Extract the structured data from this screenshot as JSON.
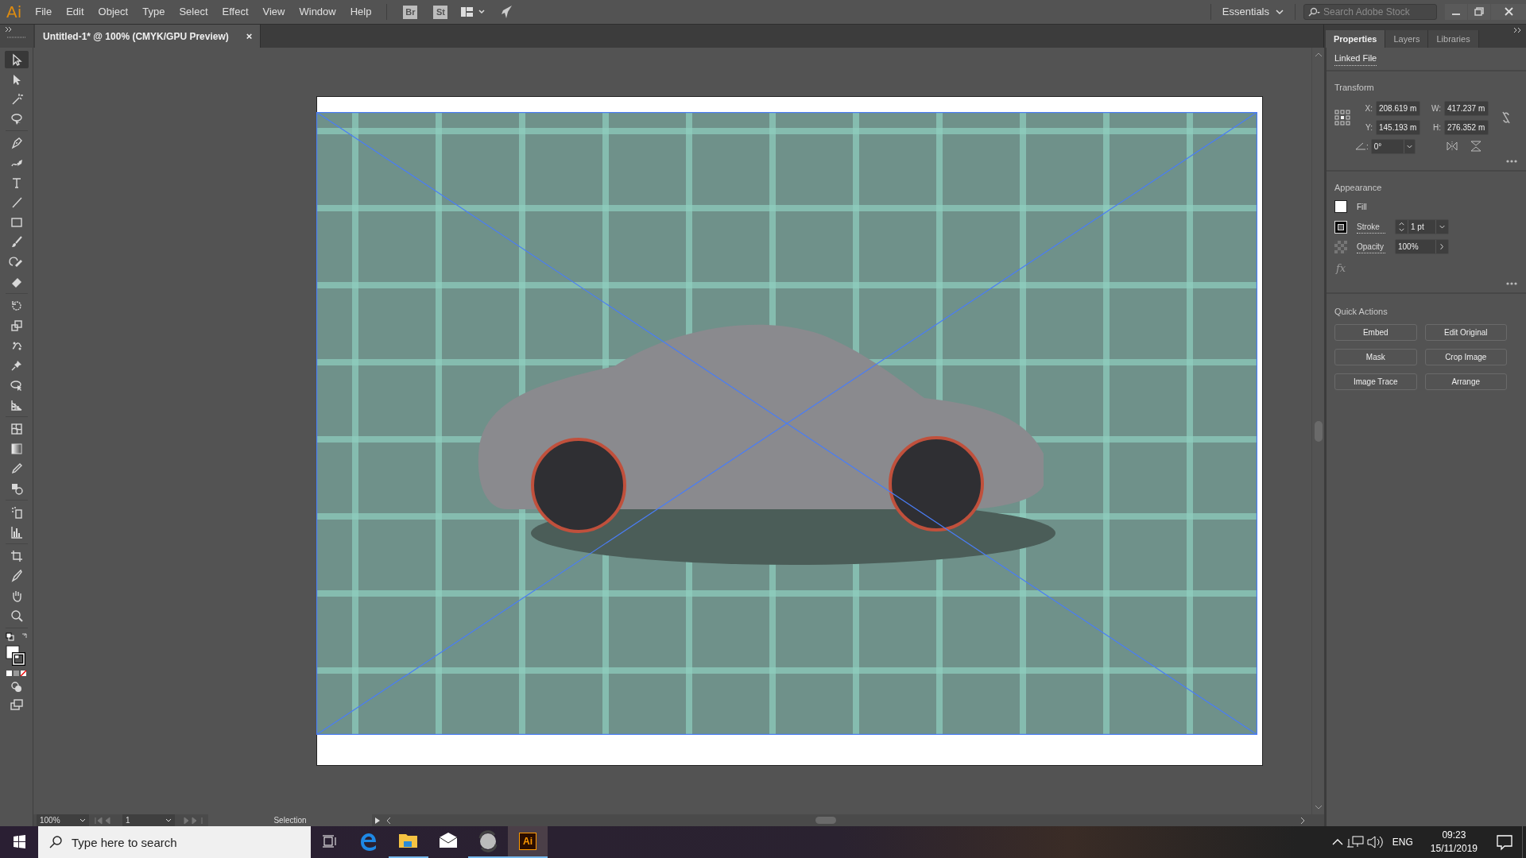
{
  "app_logo": "Ai",
  "menu": [
    "File",
    "Edit",
    "Object",
    "Type",
    "Select",
    "Effect",
    "View",
    "Window",
    "Help"
  ],
  "bridge_buttons": [
    "Br",
    "St"
  ],
  "workspace": "Essentials",
  "stock_search": {
    "placeholder": "Search Adobe Stock"
  },
  "document_tab": {
    "title": "Untitled-1* @ 100% (CMYK/GPU Preview)",
    "close": "×"
  },
  "tools": [
    {
      "kind": "selection",
      "selected": true
    },
    {
      "kind": "direct",
      "selected": false
    },
    {
      "kind": "wand",
      "selected": false
    },
    {
      "kind": "lasso",
      "selected": false
    },
    {
      "kind": "pen",
      "selected": false
    },
    {
      "kind": "curvature",
      "selected": false
    },
    {
      "kind": "type",
      "selected": false
    },
    {
      "kind": "line",
      "selected": false
    },
    {
      "kind": "rect",
      "selected": false
    },
    {
      "kind": "brush",
      "selected": false
    },
    {
      "kind": "shaper",
      "selected": false
    },
    {
      "kind": "eraser",
      "selected": false
    },
    {
      "kind": "rotate",
      "selected": false
    },
    {
      "kind": "scale",
      "selected": false
    },
    {
      "kind": "warp",
      "selected": false
    },
    {
      "kind": "pin",
      "selected": false
    },
    {
      "kind": "builder",
      "selected": false
    },
    {
      "kind": "perspective",
      "selected": false
    },
    {
      "kind": "mesh",
      "selected": false
    },
    {
      "kind": "gradient",
      "selected": false
    },
    {
      "kind": "eyedropper",
      "selected": false
    },
    {
      "kind": "blend",
      "selected": false
    },
    {
      "kind": "sprayer",
      "selected": false
    },
    {
      "kind": "graph",
      "selected": false
    },
    {
      "kind": "artboard",
      "selected": false
    },
    {
      "kind": "slice",
      "selected": false
    },
    {
      "kind": "hand",
      "selected": false
    },
    {
      "kind": "zoom",
      "selected": false
    }
  ],
  "panel": {
    "tabs": [
      {
        "label": "Properties",
        "selected": true
      },
      {
        "label": "Layers",
        "selected": false
      },
      {
        "label": "Libraries",
        "selected": false
      }
    ],
    "object_type": "Linked File",
    "transform": {
      "title": "Transform",
      "fields": [
        {
          "label": "X:",
          "value": "208.619 m"
        },
        {
          "label": "W:",
          "value": "417.237 m"
        },
        {
          "label": "Y:",
          "value": "145.193 m"
        },
        {
          "label": "H:",
          "value": "276.352 m"
        }
      ],
      "angle_label": ":",
      "angle_value": "0°"
    },
    "appearance": {
      "title": "Appearance",
      "fill_label": "Fill",
      "stroke_label": "Stroke",
      "stroke_value": "1 pt",
      "opacity_label": "Opacity",
      "opacity_value": "100%",
      "effects": "fx"
    },
    "quick_actions": {
      "title": "Quick Actions",
      "buttons": [
        "Embed",
        "Edit Original",
        "Mask",
        "Crop Image",
        "Image Trace",
        "Arrange"
      ]
    }
  },
  "status_bar": {
    "zoom": "100%",
    "artboard": "1",
    "tool": "Selection"
  },
  "taskbar": {
    "search_placeholder": "Type here to search",
    "apps": [
      {
        "kind": "edge",
        "running": false,
        "selected": false
      },
      {
        "kind": "explorer",
        "running": true,
        "selected": false
      },
      {
        "kind": "mail",
        "running": false,
        "selected": false
      },
      {
        "kind": "sync",
        "running": true,
        "selected": false
      },
      {
        "kind": "illustrator",
        "label": "Ai",
        "running": true,
        "selected": true
      }
    ],
    "language": "ENG",
    "time": "09:23",
    "date": "15/11/2019"
  }
}
